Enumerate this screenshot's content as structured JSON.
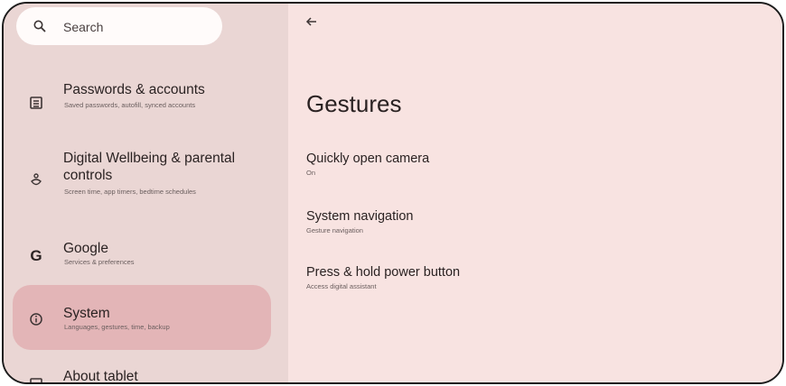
{
  "search": {
    "label": "Search"
  },
  "sidebar": {
    "items": [
      {
        "title": "Passwords & accounts",
        "subtitle": "Saved passwords, autofill, synced accounts",
        "icon": "account-box-icon"
      },
      {
        "title": "Digital Wellbeing & parental controls",
        "subtitle": "Screen time, app timers, bedtime schedules",
        "icon": "wellbeing-icon"
      },
      {
        "title": "Google",
        "subtitle": "Services & preferences",
        "icon": "google-icon"
      },
      {
        "title": "System",
        "subtitle": "Languages, gestures, time, backup",
        "icon": "info-icon",
        "selected": true
      },
      {
        "title": "About tablet",
        "subtitle": "",
        "icon": "tablet-icon"
      }
    ]
  },
  "main": {
    "title": "Gestures",
    "rows": [
      {
        "title": "Quickly open camera",
        "subtitle": "On"
      },
      {
        "title": "System navigation",
        "subtitle": "Gesture navigation"
      },
      {
        "title": "Press & hold power button",
        "subtitle": "Access digital assistant"
      }
    ]
  },
  "colors": {
    "sidebar_bg": "#ead6d4",
    "main_bg": "#f8e3e1",
    "selected_bg": "#e3b5b7",
    "text_primary": "#2a2222",
    "text_secondary": "#6a5e5e"
  }
}
